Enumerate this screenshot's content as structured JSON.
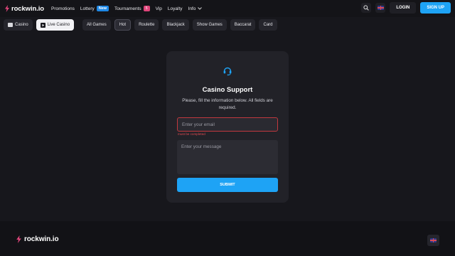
{
  "header": {
    "logo_text": "rockwin.io",
    "nav": {
      "promotions": "Promotions",
      "lottery": "Lottery",
      "lottery_badge": "New",
      "tournaments": "Tournaments",
      "tournaments_badge": "5",
      "vip": "Vip",
      "loyalty": "Loyalty",
      "info": "Info"
    },
    "login_label": "LOGIN",
    "signup_label": "SIGN UP"
  },
  "categories": {
    "casino": "Casino",
    "live_casino": "Live Casino",
    "all_games": "All Games",
    "hot": "Hot",
    "roulette": "Roulette",
    "blackjack": "Blackjack",
    "show_games": "Show Games",
    "baccarat": "Baccarat",
    "card": "Card"
  },
  "support": {
    "title": "Casino Support",
    "subtitle": "Please, fill the information below. All fields are required.",
    "email_placeholder": "Enter your email",
    "email_error": "must be completed",
    "message_placeholder": "Enter your message",
    "submit_label": "SUBMIT"
  },
  "footer": {
    "logo_text": "rockwin.io"
  },
  "colors": {
    "accent": "#1ea3f5",
    "brand_pink": "#e0457b",
    "error": "#e04b52",
    "background": "#17171c"
  }
}
